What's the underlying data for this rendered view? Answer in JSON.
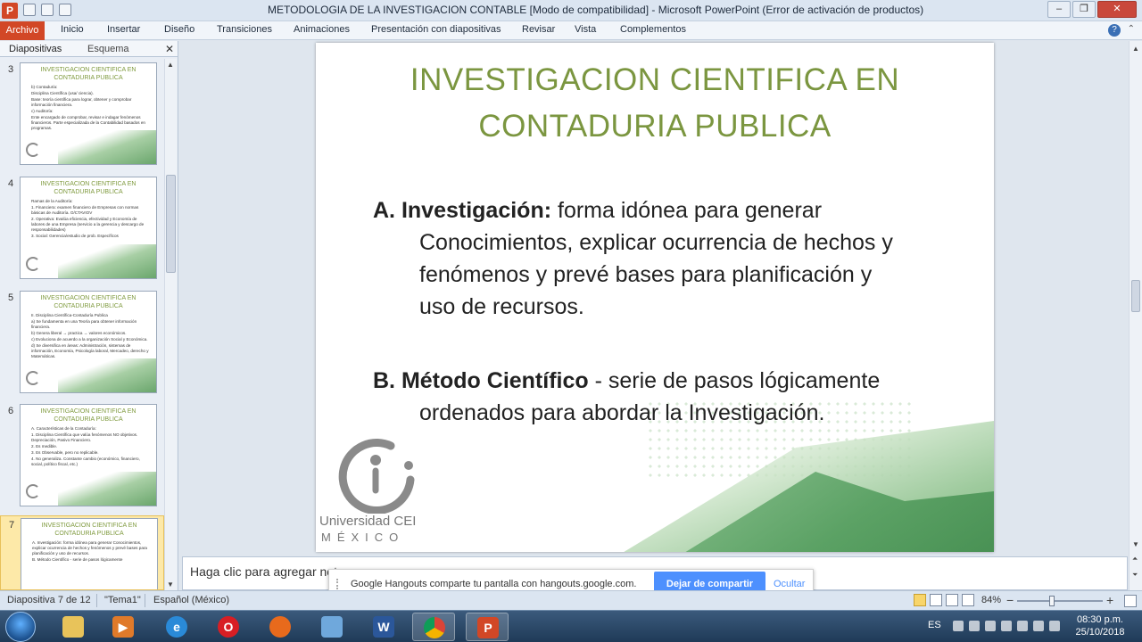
{
  "window": {
    "title": "METODOLOGIA DE LA INVESTIGACION CONTABLE [Modo de compatibilidad]  -  Microsoft PowerPoint (Error de activación de productos)"
  },
  "ribbon": {
    "file_tab": "Archivo",
    "tabs": [
      "Inicio",
      "Insertar",
      "Diseño",
      "Transiciones",
      "Animaciones",
      "Presentación con diapositivas",
      "Revisar",
      "Vista",
      "Complementos"
    ]
  },
  "left_panel": {
    "tab_slides": "Diapositivas",
    "tab_outline": "Esquema",
    "thumbnails": [
      {
        "num": "3",
        "title": "INVESTIGACION CIENTIFICA EN CONTADURIA PUBLICA",
        "lines": [
          "b) Contaduría:",
          "Disciplina Científica (usa/ ciencia).",
          "Base: teoría científica para lograr, obtener y comprobar información financiera.",
          "c) Auditoría:",
          "Ente encargado de comprobar, revisar e indagar fenómenos financieros. Parte especializada de la Contabilidad basados en programas."
        ]
      },
      {
        "num": "4",
        "title": "INVESTIGACION CIENTIFICA EN CONTADURIA PUBLICA",
        "lines": [
          "Ramas de la Auditoría:",
          "1. Financiera: examen financiero de Empresas con normas básicas de Auditoría. O/CTAVIOV",
          "2. Operativa: Evalúa eficiencia, efectividad y Economía de labores de una Empresa (servicio a la gerencia y descargo de responsabilidades)",
          "3. Social: Gerencia/estudio de prob. Específicos"
        ]
      },
      {
        "num": "5",
        "title": "INVESTIGACION CIENTIFICA EN CONTADURIA PUBLICA",
        "lines": [
          "II. Disciplina Científica-Contaduría Publica",
          "a) Se fundamenta en una Teoría para obtener información financiera.",
          "b) Genera liberal → practica → valores económicos.",
          "c) Evoluciona de acuerdo a la organización Social y Económica.",
          "d) Se diversifica en áreas: Administración, sistemas de información, Economía, Psicología laboral, Mercadeo, derecho y Matemáticas."
        ]
      },
      {
        "num": "6",
        "title": "INVESTIGACION CIENTIFICA EN CONTADURIA PUBLICA",
        "lines": [
          "A. Características de la Contaduría:",
          "1. Disciplina Científica que valúa fenómenos NO objetivos. Depreciación, Pasivo Financiero.",
          "2. Es medible.",
          "3. Es Observable, pero no replicable.",
          "4. No generaliza. Constante cambio (económico, financiero, social, político fiscal, etc.)"
        ]
      },
      {
        "num": "7",
        "title": "INVESTIGACION CIENTIFICA EN CONTADURIA PUBLICA",
        "lines": [
          "A. Investigación: forma idónea para generar Conocimientos, explicar ocurrencia de hechos y fenómenos y prevé bases para planificación y uso de recursos.",
          "B. Método Científico - serie de pasos lógicamente"
        ]
      }
    ]
  },
  "slide": {
    "title_line1": "INVESTIGACION CIENTIFICA EN",
    "title_line2": "CONTADURIA PUBLICA",
    "a_label": "A. Investigación:",
    "a_line1": " forma idónea para generar",
    "a_line2": "Conocimientos, explicar ocurrencia de hechos y",
    "a_line3": "fenómenos y prevé bases para planificación y",
    "a_line4": "uso de recursos.",
    "b_label": "B.  Método Científico",
    "b_line1": " - serie de pasos lógicamente",
    "b_line2": "ordenados para abordar la Investigación.",
    "logo_text1": "Universidad CEI",
    "logo_text2": "MÉXICO"
  },
  "notes": {
    "placeholder": "Haga clic para agregar notas"
  },
  "hangouts_bar": {
    "message": "Google Hangouts comparte tu pantalla con hangouts.google.com.",
    "stop_button": "Dejar de compartir",
    "hide_link": "Ocultar"
  },
  "status_bar": {
    "slide_counter": "Diapositiva 7 de 12",
    "theme": "\"Tema1\"",
    "language": "Español (México)",
    "zoom": "84%",
    "zoom_level": 0.84
  },
  "taskbar": {
    "apps": [
      {
        "icon": "explorer-folder-icon"
      },
      {
        "icon": "media-player-icon"
      },
      {
        "icon": "internet-explorer-icon"
      },
      {
        "icon": "opera-icon"
      },
      {
        "icon": "firefox-icon"
      },
      {
        "icon": "paint-icon"
      },
      {
        "icon": "word-icon",
        "label": "W"
      },
      {
        "icon": "chrome-icon"
      },
      {
        "icon": "powerpoint-icon",
        "label": "P"
      }
    ],
    "lang": "ES",
    "time": "08:30 p.m.",
    "date": "25/10/2018"
  },
  "colors": {
    "title_green": "#7b9640",
    "file_tab": "#d24726",
    "hangouts_blue": "#4d90fe",
    "selected_thumb": "#fde9a8"
  }
}
